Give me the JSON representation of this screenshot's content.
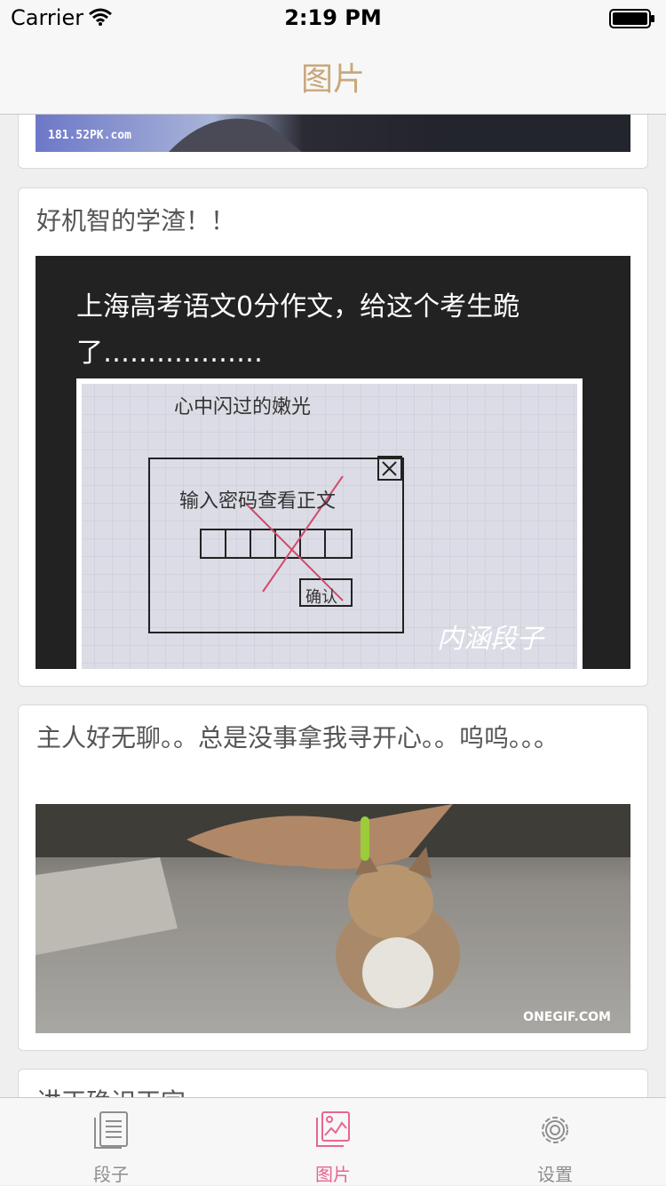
{
  "status_bar": {
    "carrier": "Carrier",
    "time": "2:19 PM"
  },
  "nav": {
    "title": "图片"
  },
  "cards": [
    {
      "text": "",
      "image_caption": "181.52PK.com"
    },
    {
      "text": "好机智的学渣！！",
      "image_text_line1": "上海高考语文0分作文，给这个考生跪",
      "image_text_line2": "了………………",
      "handwriting_title": "心中闪过的嫩光",
      "handwriting_prompt": "输入密码查看正文",
      "handwriting_button": "确认",
      "watermark": "内涵段子"
    },
    {
      "text": "主人好无聊。。总是没事拿我寻开心。。呜呜。。。",
      "watermark": "ONEGIF.COM"
    },
    {
      "text": "讲正确识正字"
    }
  ],
  "tabs": [
    {
      "label": "段子",
      "icon": "document-list-icon",
      "active": false
    },
    {
      "label": "图片",
      "icon": "picture-icon",
      "active": true
    },
    {
      "label": "设置",
      "icon": "gear-icon",
      "active": false
    }
  ],
  "colors": {
    "accent_title": "#c9a77a",
    "active_tab": "#e8668f",
    "inactive_tab": "#8e8e8e"
  }
}
